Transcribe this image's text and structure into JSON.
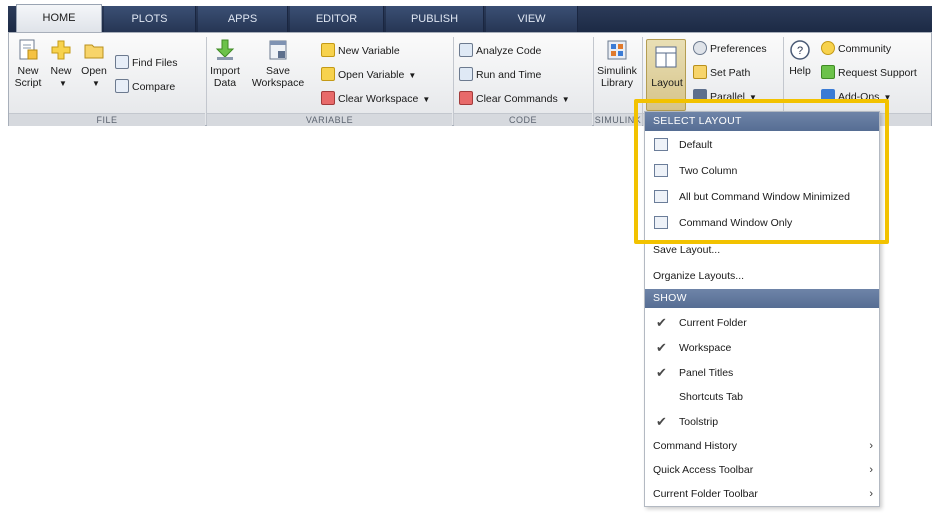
{
  "tabs": [
    {
      "label": "HOME",
      "active": true
    },
    {
      "label": "PLOTS",
      "active": false
    },
    {
      "label": "APPS",
      "active": false
    },
    {
      "label": "EDITOR",
      "active": false
    },
    {
      "label": "PUBLISH",
      "active": false
    },
    {
      "label": "VIEW",
      "active": false
    }
  ],
  "ribbon": {
    "file": {
      "section": "FILE",
      "new_script": [
        "New",
        "Script"
      ],
      "new": "New",
      "open": "Open",
      "find_files": "Find Files",
      "compare": "Compare"
    },
    "variable": {
      "section": "VARIABLE",
      "import_data": [
        "Import",
        "Data"
      ],
      "save_workspace": [
        "Save",
        "Workspace"
      ],
      "new_variable": "New Variable",
      "open_variable": "Open Variable",
      "clear_workspace": "Clear Workspace"
    },
    "code": {
      "section": "CODE",
      "analyze_code": "Analyze Code",
      "run_and_time": "Run and Time",
      "clear_commands": "Clear Commands"
    },
    "simulink": {
      "section": "SIMULINK",
      "library": [
        "Simulink",
        "Library"
      ]
    },
    "environment": {
      "layout": "Layout",
      "preferences": "Preferences",
      "set_path": "Set Path",
      "parallel": "Parallel"
    },
    "resources": {
      "help": "Help",
      "community": "Community",
      "request_support": "Request Support",
      "add_ons": "Add-Ons"
    }
  },
  "dropdown": {
    "select_layout_header": "SELECT LAYOUT",
    "layouts": [
      "Default",
      "Two Column",
      "All but Command Window Minimized",
      "Command Window Only"
    ],
    "save_layout": "Save Layout...",
    "organize_layouts": "Organize Layouts...",
    "show_header": "SHOW",
    "show_items": [
      {
        "label": "Current Folder",
        "checked": true
      },
      {
        "label": "Workspace",
        "checked": true
      },
      {
        "label": "Panel Titles",
        "checked": true
      },
      {
        "label": "Shortcuts Tab",
        "checked": false
      },
      {
        "label": "Toolstrip",
        "checked": true
      }
    ],
    "submenus": [
      "Command History",
      "Quick Access Toolbar",
      "Current Folder Toolbar"
    ],
    "check_glyph": "✔",
    "arrow_glyph": "›"
  },
  "colors": {
    "highlight": "#f2c200",
    "header": "#566d93",
    "tabbar": "#1c2a45"
  }
}
